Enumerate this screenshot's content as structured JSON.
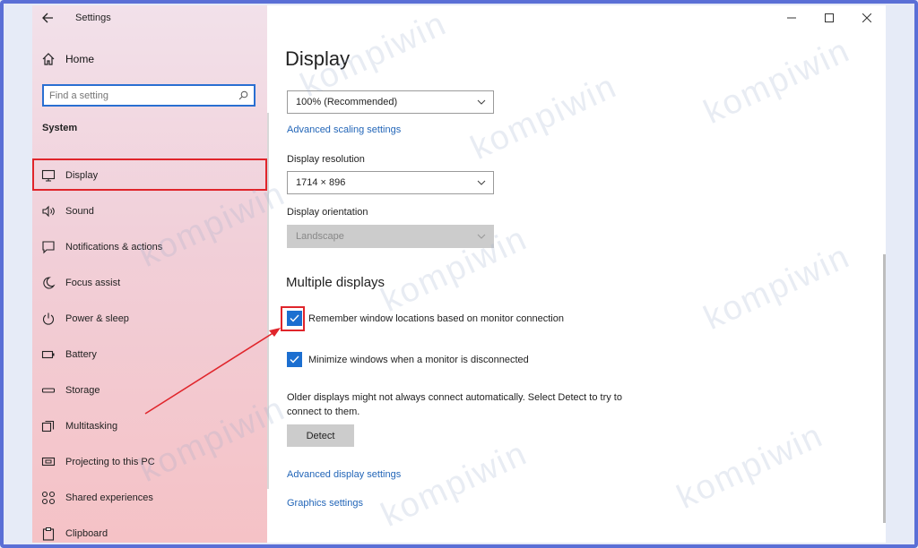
{
  "window": {
    "title": "Settings"
  },
  "sidebar": {
    "home_label": "Home",
    "search_placeholder": "Find a setting",
    "section_label": "System",
    "items": [
      {
        "label": "Display",
        "icon": "monitor-icon"
      },
      {
        "label": "Sound",
        "icon": "speaker-icon"
      },
      {
        "label": "Notifications & actions",
        "icon": "notification-icon"
      },
      {
        "label": "Focus assist",
        "icon": "moon-icon"
      },
      {
        "label": "Power & sleep",
        "icon": "power-icon"
      },
      {
        "label": "Battery",
        "icon": "battery-icon"
      },
      {
        "label": "Storage",
        "icon": "storage-icon"
      },
      {
        "label": "Multitasking",
        "icon": "multitasking-icon"
      },
      {
        "label": "Projecting to this PC",
        "icon": "projector-icon"
      },
      {
        "label": "Shared experiences",
        "icon": "shared-icon"
      },
      {
        "label": "Clipboard",
        "icon": "clipboard-icon"
      }
    ]
  },
  "main": {
    "title": "Display",
    "scale_value": "100% (Recommended)",
    "advanced_scaling_link": "Advanced scaling settings",
    "resolution_label": "Display resolution",
    "resolution_value": "1714 × 896",
    "orientation_label": "Display orientation",
    "orientation_value": "Landscape",
    "multiple_displays_title": "Multiple displays",
    "remember_label": "Remember window locations based on monitor connection",
    "minimize_label": "Minimize windows when a monitor is disconnected",
    "older_text": "Older displays might not always connect automatically. Select Detect to try to connect to them.",
    "detect_label": "Detect",
    "advanced_display_link": "Advanced display settings",
    "graphics_link": "Graphics settings"
  },
  "watermark": "kompiwin",
  "colors": {
    "accent": "#1c6fd0",
    "highlight": "#e0252b",
    "link": "#2366b8"
  }
}
